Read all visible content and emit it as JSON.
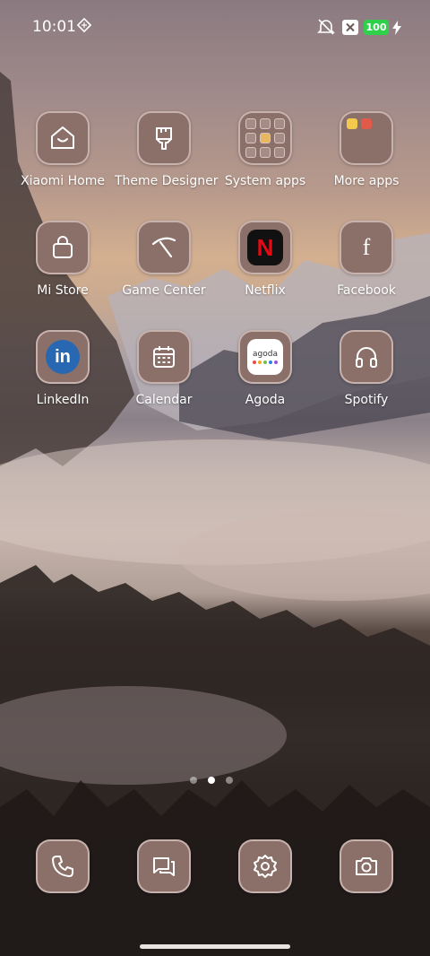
{
  "status_bar": {
    "time": "10:01",
    "battery_level": "100",
    "icons": [
      "nfc-icon",
      "vibrate-icon",
      "no-sim-icon",
      "charging-icon"
    ]
  },
  "apps": [
    {
      "label": "Xiaomi Home",
      "icon": "xiaomi-home-icon"
    },
    {
      "label": "Theme Designer",
      "icon": "brush-icon"
    },
    {
      "label": "System apps",
      "icon": "folder-icon"
    },
    {
      "label": "More apps",
      "icon": "folder-icon"
    },
    {
      "label": "Mi Store",
      "icon": "shopping-bag-icon"
    },
    {
      "label": "Game Center",
      "icon": "game-center-icon"
    },
    {
      "label": "Netflix",
      "icon": "netflix-icon"
    },
    {
      "label": "Facebook",
      "icon": "facebook-icon"
    },
    {
      "label": "LinkedIn",
      "icon": "linkedin-icon"
    },
    {
      "label": "Calendar",
      "icon": "calendar-icon"
    },
    {
      "label": "Agoda",
      "icon": "agoda-icon"
    },
    {
      "label": "Spotify",
      "icon": "headphones-icon"
    }
  ],
  "agoda_logo_text": "agoda",
  "linkedin_logo_text": "in",
  "facebook_logo_text": "f",
  "netflix_logo_text": "N",
  "page_indicator": {
    "pages": 3,
    "current": 2
  },
  "dock": [
    {
      "name": "phone",
      "icon": "phone-icon"
    },
    {
      "name": "messages",
      "icon": "messages-icon"
    },
    {
      "name": "settings",
      "icon": "settings-icon"
    },
    {
      "name": "camera",
      "icon": "camera-icon"
    }
  ],
  "colors": {
    "tile": "#8b6f69",
    "battery": "#2fd04a",
    "linkedin": "#2867b2",
    "netflix": "#e50914"
  }
}
